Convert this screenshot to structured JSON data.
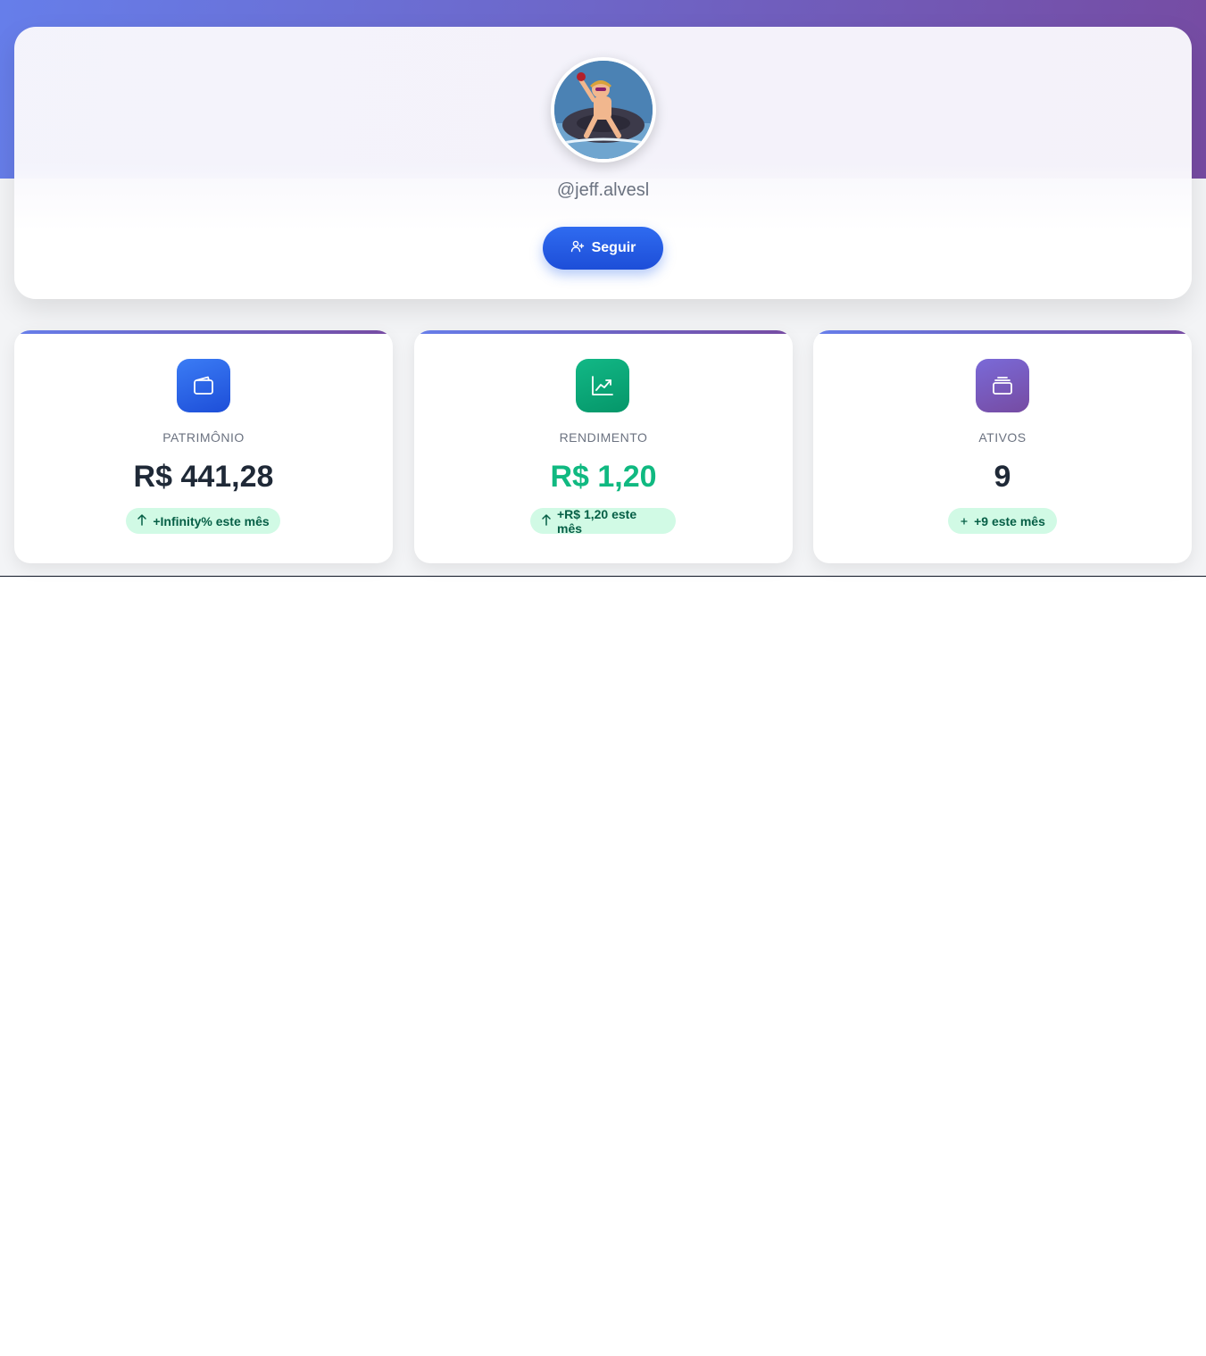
{
  "profile": {
    "username": "@jeff.alvesl",
    "follow_label": "Seguir"
  },
  "stats": [
    {
      "label": "PATRIMÔNIO",
      "value": "R$ 441,28",
      "change": "+Infinity% este mês",
      "icon": "wallet-icon",
      "change_icon": "arrow-up-icon",
      "accent": "#2563eb"
    },
    {
      "label": "RENDIMENTO",
      "value": "R$ 1,20",
      "change": "+R$ 1,20 este mês",
      "icon": "trending-up-icon",
      "change_icon": "arrow-up-icon",
      "accent": "#10b981"
    },
    {
      "label": "ATIVOS",
      "value": "9",
      "change": "+9 este mês",
      "icon": "layers-icon",
      "change_icon": "plus-icon",
      "accent": "#764ba2"
    }
  ],
  "colors": {
    "hero_gradient_start": "#667eea",
    "hero_gradient_end": "#764ba2",
    "positive": "#10b981",
    "badge_bg": "#d1fae5",
    "badge_text": "#065f46"
  }
}
